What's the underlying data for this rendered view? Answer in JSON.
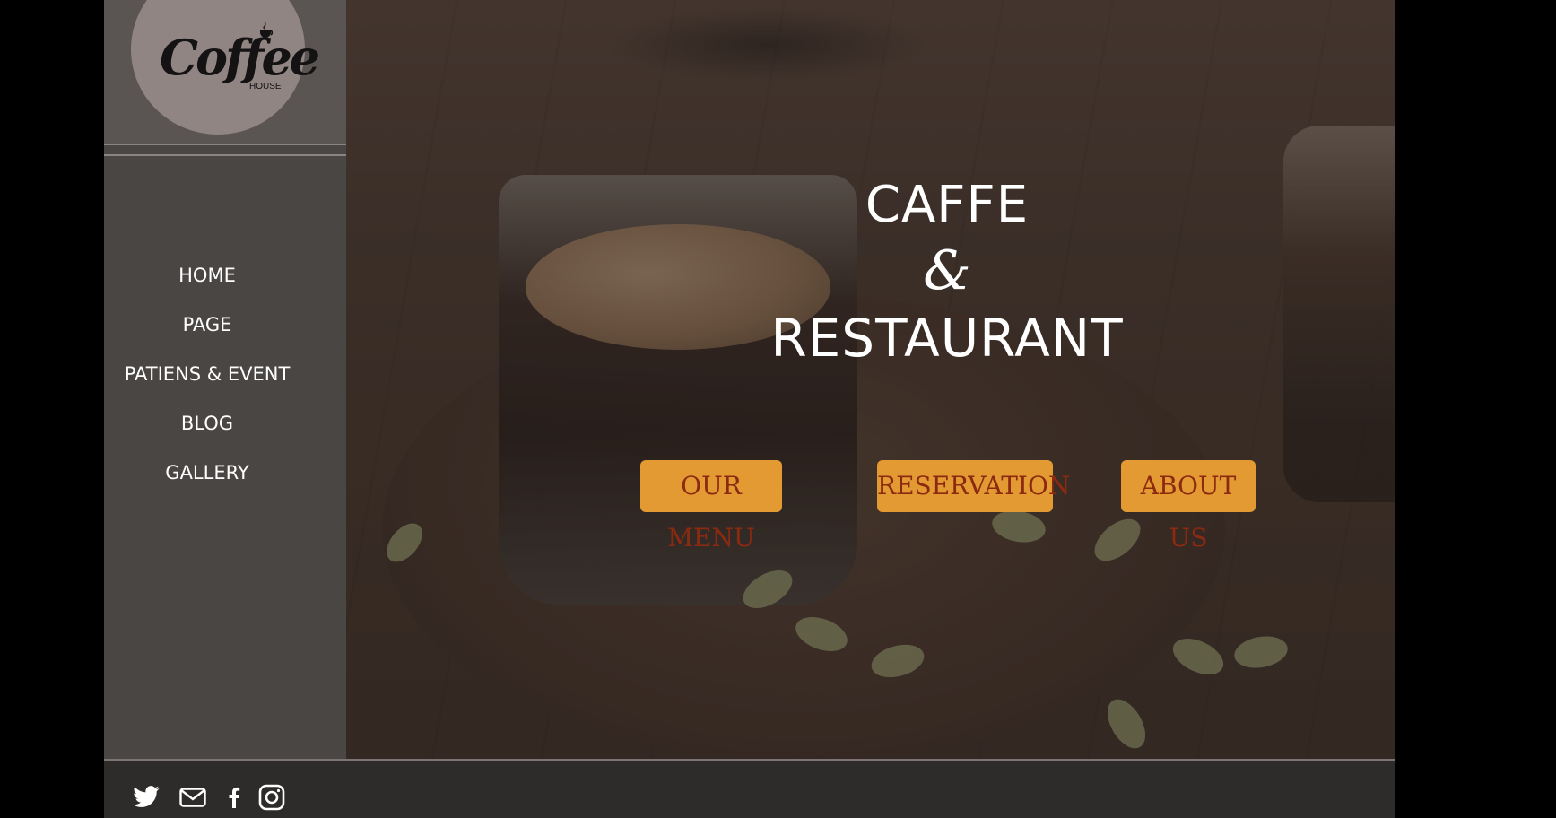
{
  "logo": {
    "word": "Coffee",
    "sub": "HOUSE"
  },
  "nav": {
    "items": [
      {
        "label": "HOME"
      },
      {
        "label": "PAGE"
      },
      {
        "label": "PATIENS & EVENT"
      },
      {
        "label": "BLOG"
      },
      {
        "label": "GALLERY"
      }
    ]
  },
  "hero": {
    "line1": "CAFFE",
    "amp": "&",
    "line2": "RESTAURANT"
  },
  "buttons": {
    "menu": "OUR MENU",
    "reservation": "RESERVATION",
    "about": "ABOUT US"
  },
  "colors": {
    "accent": "#e39a32",
    "button_text": "#8b2a10",
    "sidebar": "#4a4644"
  },
  "footer": {
    "icons": [
      "twitter-icon",
      "mail-icon",
      "facebook-icon",
      "instagram-icon"
    ]
  }
}
